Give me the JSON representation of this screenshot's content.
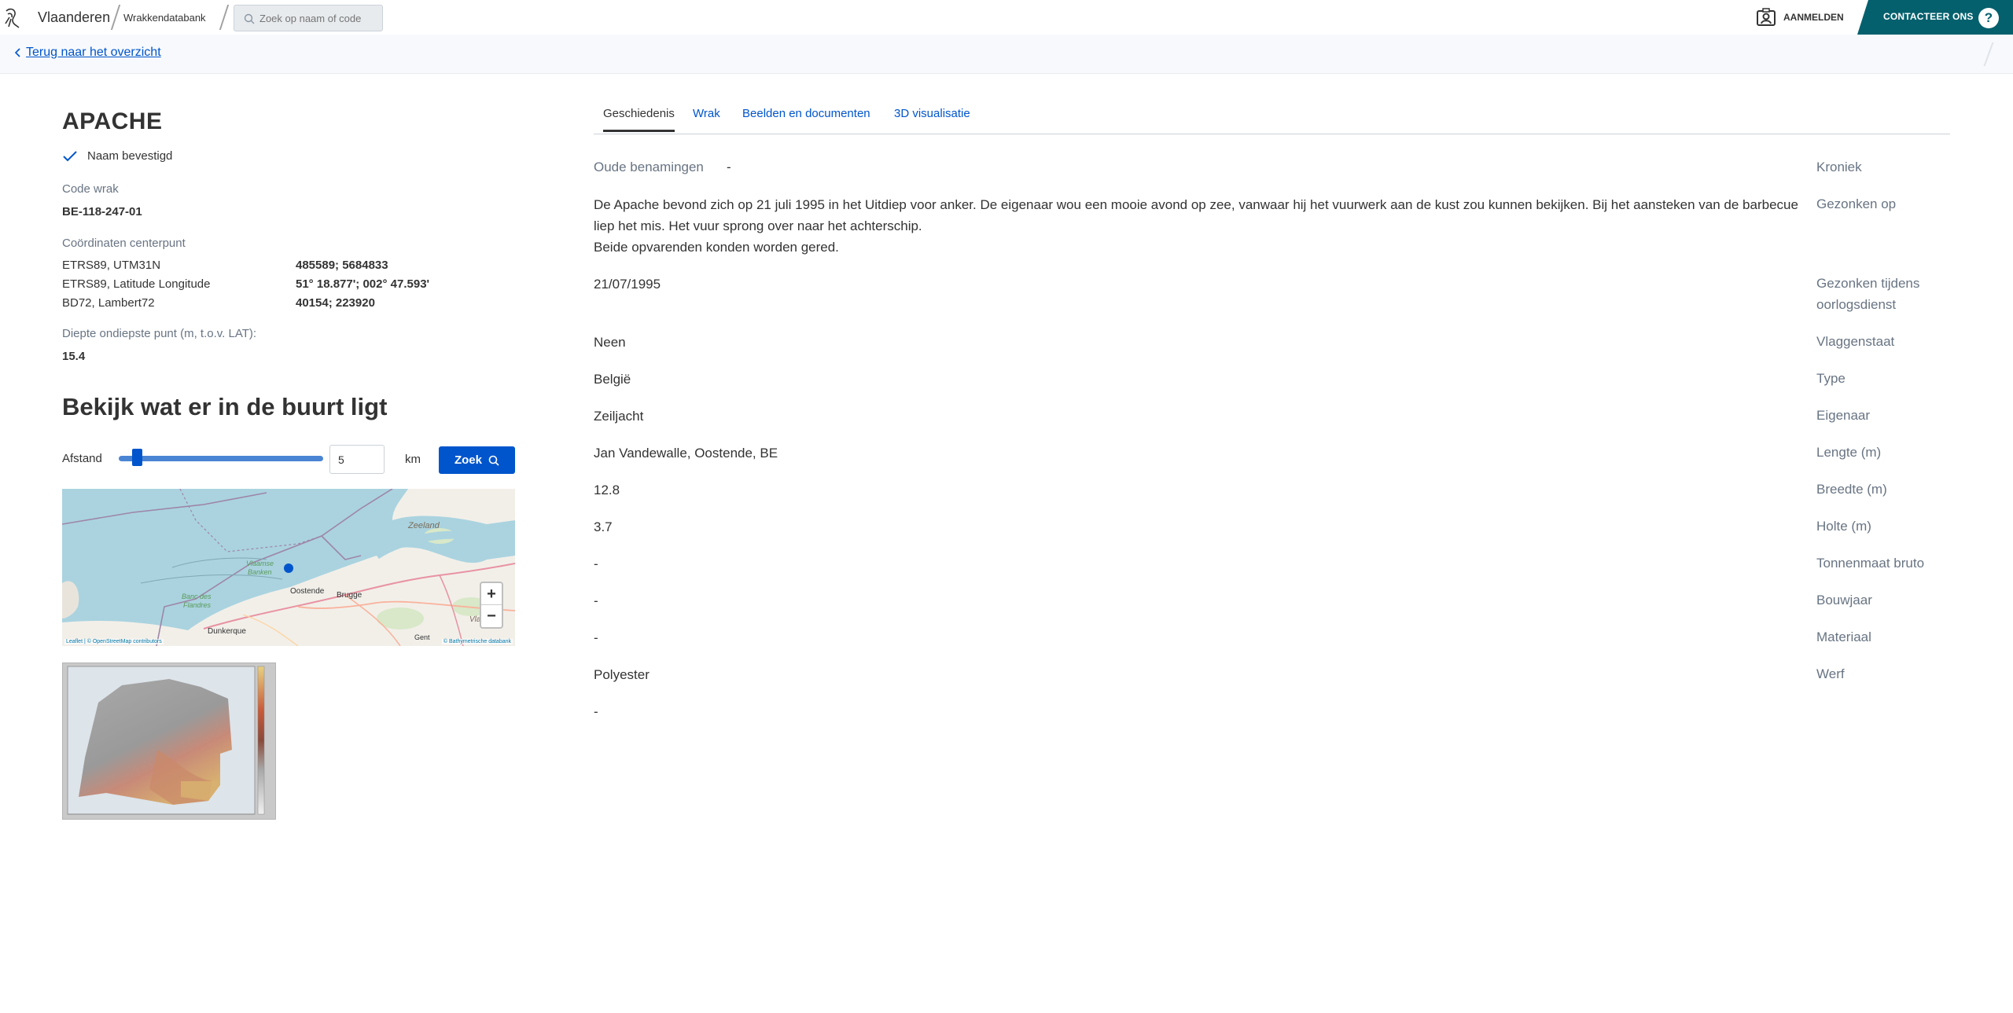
{
  "header": {
    "brand": "Vlaanderen",
    "site": "Wrakkendatabank",
    "search_placeholder": "Zoek op naam of code",
    "login_label": "AANMELDEN",
    "contact_label": "CONTACTEER ONS",
    "help_label": "?"
  },
  "back_link": "Terug naar het overzicht",
  "wreck": {
    "name": "APACHE",
    "name_status": "Naam bevestigd",
    "code_label": "Code wrak",
    "code": "BE-118-247-01",
    "coords_label": "Coördinaten centerpunt",
    "coords": [
      {
        "system": "ETRS89, UTM31N",
        "value": "485589; 5684833"
      },
      {
        "system": "ETRS89, Latitude Longitude",
        "value": "51° 18.877'; 002° 47.593'"
      },
      {
        "system": "BD72, Lambert72",
        "value": "40154; 223920"
      }
    ],
    "depth_label": "Diepte ondiepste punt (m, t.o.v. LAT):",
    "depth": "15.4"
  },
  "nearby": {
    "heading": "Bekijk wat er in de buurt ligt",
    "distance_label": "Afstand",
    "distance_value": 5,
    "distance_fraction": 0.07,
    "unit": "km",
    "search_button": "Zoek"
  },
  "map": {
    "labels": {
      "zeeland": "Zeeland",
      "vlaamse": "Vlaamse",
      "banken": "Banken",
      "oostende": "Oostende",
      "brugge": "Brugge",
      "banc1": "Banc des",
      "banc2": "Flandres",
      "dunkerque": "Dunkerque",
      "gent": "Gent",
      "vla": "Vla"
    },
    "attribution_left": "Leaflet | © OpenStreetMap contributors",
    "attribution_right": "© Bathymetrische databank",
    "zoom_in": "+",
    "zoom_out": "−"
  },
  "tabs": [
    {
      "label": "Geschiedenis",
      "active": true
    },
    {
      "label": "Wrak",
      "active": false
    },
    {
      "label": "Beelden en documenten",
      "active": false
    },
    {
      "label": "3D visualisatie",
      "active": false
    }
  ],
  "details": {
    "oude_benamingen_label": "Oude benamingen",
    "oude_benamingen": "-",
    "kroniek_label": "Kroniek",
    "kroniek": "De Apache bevond zich op 21 juli 1995 in het Uitdiep voor anker. De eigenaar wou een mooie avond op zee, vanwaar hij het vuurwerk aan de kust zou kunnen bekijken. Bij het aansteken van de barbecue liep het mis. Het vuur sprong over naar het achterschip.",
    "kroniek_2": "Beide opvarenden konden worden gered.",
    "gezonken_op_label": "Gezonken op",
    "gezonken_op": "21/07/1995",
    "oorlog_label_1": "Gezonken tijdens",
    "oorlog_label_2": "oorlogsdienst",
    "oorlog": "Neen",
    "vlaggenstaat_label": "Vlaggenstaat",
    "vlaggenstaat": "België",
    "type_label": "Type",
    "type": "Zeiljacht",
    "eigenaar_label": "Eigenaar",
    "eigenaar": "Jan Vandewalle, Oostende, BE",
    "lengte_label": "Lengte (m)",
    "lengte": "12.8",
    "breedte_label": "Breedte (m)",
    "breedte": "3.7",
    "holte_label": "Holte (m)",
    "holte": "-",
    "tonnenmaat_label": "Tonnenmaat bruto",
    "tonnenmaat": "-",
    "bouwjaar_label": "Bouwjaar",
    "bouwjaar": "-",
    "materiaal_label": "Materiaal",
    "materiaal": "Polyester",
    "werf_label": "Werf",
    "werf": "-"
  }
}
